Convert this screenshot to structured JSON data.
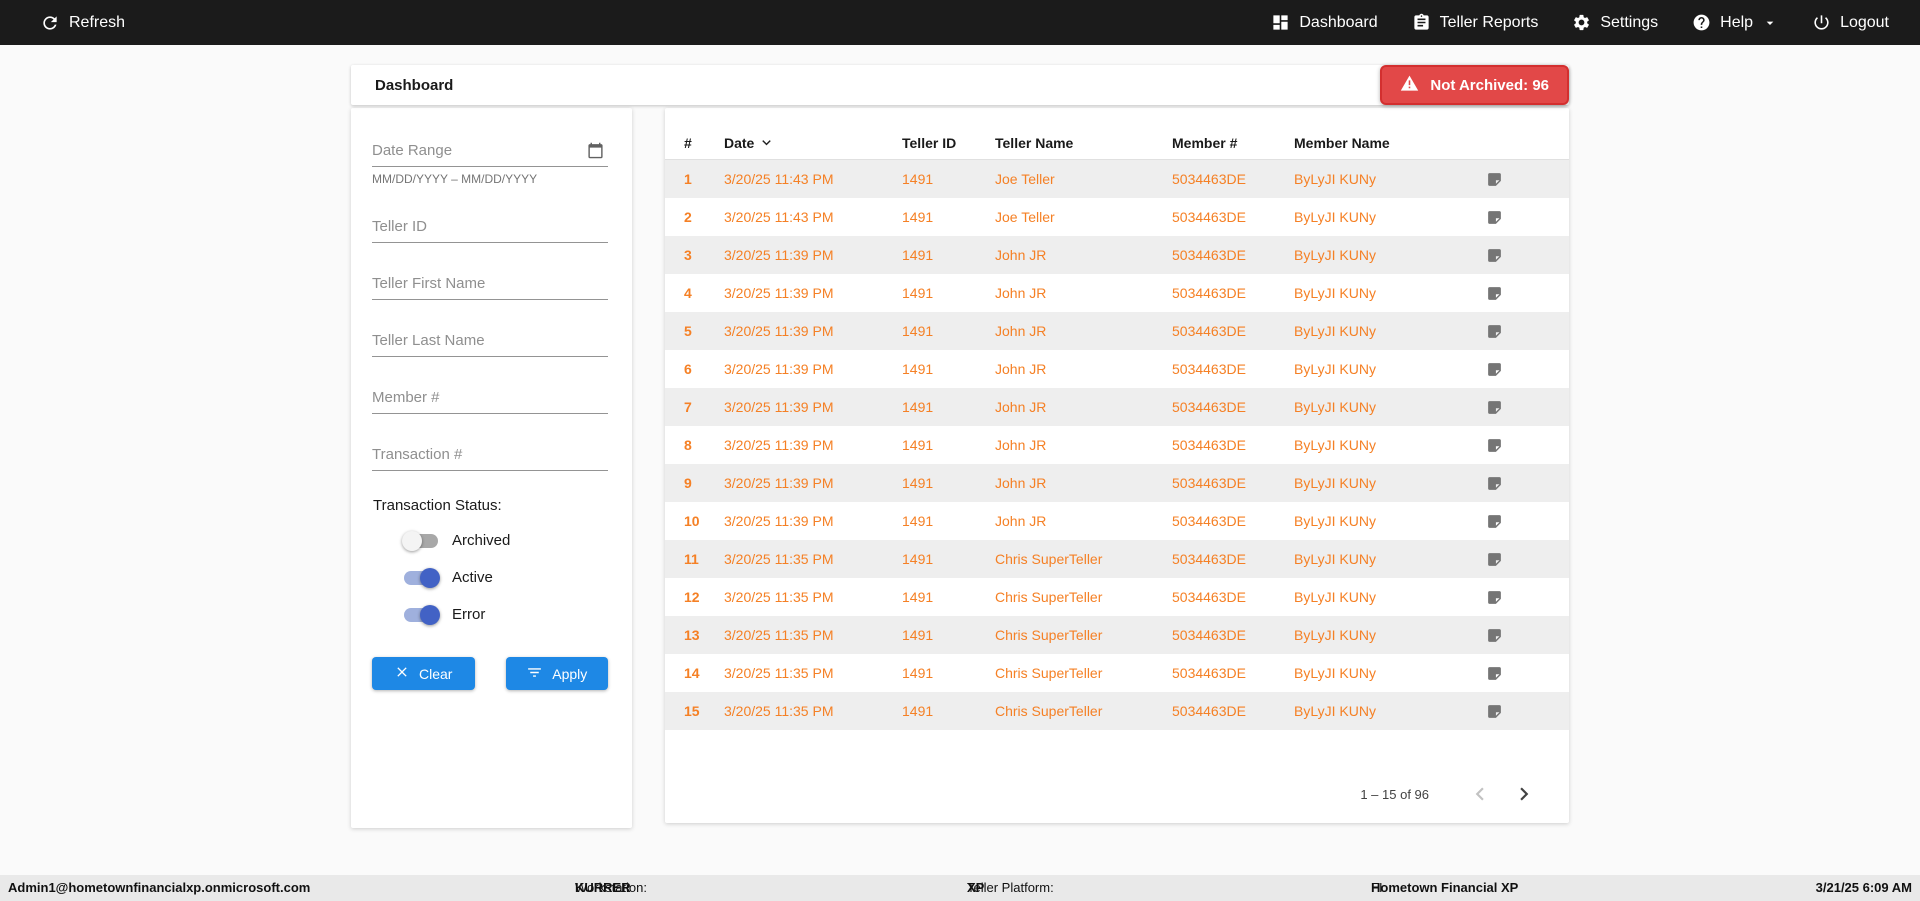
{
  "navbar": {
    "refresh_label": "Refresh",
    "items": [
      {
        "label": "Dashboard",
        "icon": "dashboard-icon"
      },
      {
        "label": "Teller Reports",
        "icon": "teller-reports-icon"
      },
      {
        "label": "Settings",
        "icon": "settings-gear-icon"
      },
      {
        "label": "Help",
        "icon": "help-icon",
        "dropdown": true
      },
      {
        "label": "Logout",
        "icon": "logout-power-icon"
      }
    ]
  },
  "header": {
    "title": "Dashboard",
    "badge": {
      "label": "Not Archived: 96",
      "icon": "warning-triangle-icon"
    }
  },
  "filters": {
    "date_range_placeholder": "Date Range",
    "date_range_hint": "MM/DD/YYYY – MM/DD/YYYY",
    "teller_id_placeholder": "Teller ID",
    "teller_first_name_placeholder": "Teller First Name",
    "teller_last_name_placeholder": "Teller Last Name",
    "member_number_placeholder": "Member #",
    "transaction_number_placeholder": "Transaction #",
    "status_label": "Transaction Status:",
    "toggles": [
      {
        "label": "Archived",
        "on": false
      },
      {
        "label": "Active",
        "on": true
      },
      {
        "label": "Error",
        "on": true
      }
    ],
    "clear_label": "Clear",
    "apply_label": "Apply"
  },
  "table": {
    "columns": [
      "#",
      "Date",
      "Teller ID",
      "Teller Name",
      "Member #",
      "Member Name"
    ],
    "sorted_column": "Date",
    "sort_direction": "desc",
    "rows": [
      {
        "num": "1",
        "date": "3/20/25 11:43 PM",
        "teller_id": "1491",
        "teller_name": "Joe Teller",
        "member_num": "5034463DE",
        "member_name": "ByLyJI KUNy"
      },
      {
        "num": "2",
        "date": "3/20/25 11:43 PM",
        "teller_id": "1491",
        "teller_name": "Joe Teller",
        "member_num": "5034463DE",
        "member_name": "ByLyJI KUNy"
      },
      {
        "num": "3",
        "date": "3/20/25 11:39 PM",
        "teller_id": "1491",
        "teller_name": "John JR",
        "member_num": "5034463DE",
        "member_name": "ByLyJI KUNy"
      },
      {
        "num": "4",
        "date": "3/20/25 11:39 PM",
        "teller_id": "1491",
        "teller_name": "John JR",
        "member_num": "5034463DE",
        "member_name": "ByLyJI KUNy"
      },
      {
        "num": "5",
        "date": "3/20/25 11:39 PM",
        "teller_id": "1491",
        "teller_name": "John JR",
        "member_num": "5034463DE",
        "member_name": "ByLyJI KUNy"
      },
      {
        "num": "6",
        "date": "3/20/25 11:39 PM",
        "teller_id": "1491",
        "teller_name": "John JR",
        "member_num": "5034463DE",
        "member_name": "ByLyJI KUNy"
      },
      {
        "num": "7",
        "date": "3/20/25 11:39 PM",
        "teller_id": "1491",
        "teller_name": "John JR",
        "member_num": "5034463DE",
        "member_name": "ByLyJI KUNy"
      },
      {
        "num": "8",
        "date": "3/20/25 11:39 PM",
        "teller_id": "1491",
        "teller_name": "John JR",
        "member_num": "5034463DE",
        "member_name": "ByLyJI KUNy"
      },
      {
        "num": "9",
        "date": "3/20/25 11:39 PM",
        "teller_id": "1491",
        "teller_name": "John JR",
        "member_num": "5034463DE",
        "member_name": "ByLyJI KUNy"
      },
      {
        "num": "10",
        "date": "3/20/25 11:39 PM",
        "teller_id": "1491",
        "teller_name": "John JR",
        "member_num": "5034463DE",
        "member_name": "ByLyJI KUNy"
      },
      {
        "num": "11",
        "date": "3/20/25 11:35 PM",
        "teller_id": "1491",
        "teller_name": "Chris SuperTeller",
        "member_num": "5034463DE",
        "member_name": "ByLyJI KUNy"
      },
      {
        "num": "12",
        "date": "3/20/25 11:35 PM",
        "teller_id": "1491",
        "teller_name": "Chris SuperTeller",
        "member_num": "5034463DE",
        "member_name": "ByLyJI KUNy"
      },
      {
        "num": "13",
        "date": "3/20/25 11:35 PM",
        "teller_id": "1491",
        "teller_name": "Chris SuperTeller",
        "member_num": "5034463DE",
        "member_name": "ByLyJI KUNy"
      },
      {
        "num": "14",
        "date": "3/20/25 11:35 PM",
        "teller_id": "1491",
        "teller_name": "Chris SuperTeller",
        "member_num": "5034463DE",
        "member_name": "ByLyJI KUNy"
      },
      {
        "num": "15",
        "date": "3/20/25 11:35 PM",
        "teller_id": "1491",
        "teller_name": "Chris SuperTeller",
        "member_num": "5034463DE",
        "member_name": "ByLyJI KUNy"
      }
    ],
    "pagination": {
      "label": "1 – 15 of 96"
    }
  },
  "footer": {
    "user": "Admin1@hometownfinancialxp.onmicrosoft.com",
    "workstation_label": "Workstation:",
    "workstation_value": "KURRER",
    "platform_label": "Teller Platform:",
    "platform_value": "XP",
    "fi_label": "FI:",
    "fi_value": "Hometown Financial XP",
    "datetime": "3/21/25 6:09 AM"
  },
  "colors": {
    "navbar_bg": "#1B1B1B",
    "accent_orange": "#F58025",
    "badge_bg": "#E24848",
    "badge_border": "#D32F2F",
    "button_blue": "#1E88E5",
    "toggle_on": "#4262C5",
    "row_alt": "#EEEEEE",
    "footer_bg": "#E9E9E9"
  }
}
